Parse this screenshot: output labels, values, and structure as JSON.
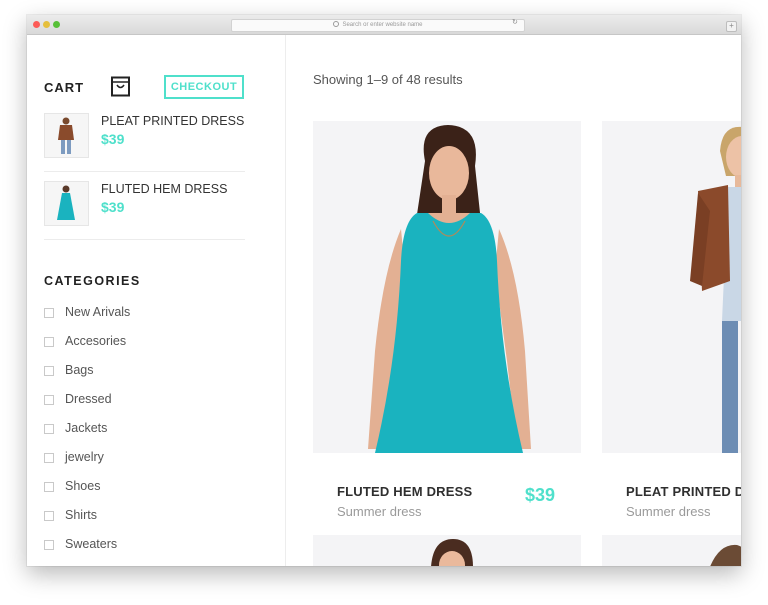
{
  "browser": {
    "address_placeholder": "Search or enter website name",
    "reload_icon": "reload-icon",
    "new_tab_icon": "plus-icon"
  },
  "cart": {
    "title": "CART",
    "icon": "shopping-bag-icon",
    "checkout_label": "CHECKOUT",
    "items": [
      {
        "name": "PLEAT PRINTED DRESS",
        "price": "$39"
      },
      {
        "name": "FLUTED HEM DRESS",
        "price": "$39"
      }
    ]
  },
  "categories": {
    "title": "CATEGORIES",
    "items": [
      "New Arivals",
      "Accesories",
      "Bags",
      "Dressed",
      "Jackets",
      "jewelry",
      "Shoes",
      "Shirts",
      "Sweaters"
    ]
  },
  "results": {
    "showing_text": "Showing 1–9 of 48 results"
  },
  "products": [
    {
      "name": "FLUTED HEM DRESS",
      "subtitle": "Summer dress",
      "price": "$39"
    },
    {
      "name": "PLEAT PRINTED DRESS",
      "subtitle": "Summer dress",
      "price": ""
    }
  ],
  "colors": {
    "accent": "#4fe0cb",
    "dress_teal": "#1ab3bf"
  }
}
